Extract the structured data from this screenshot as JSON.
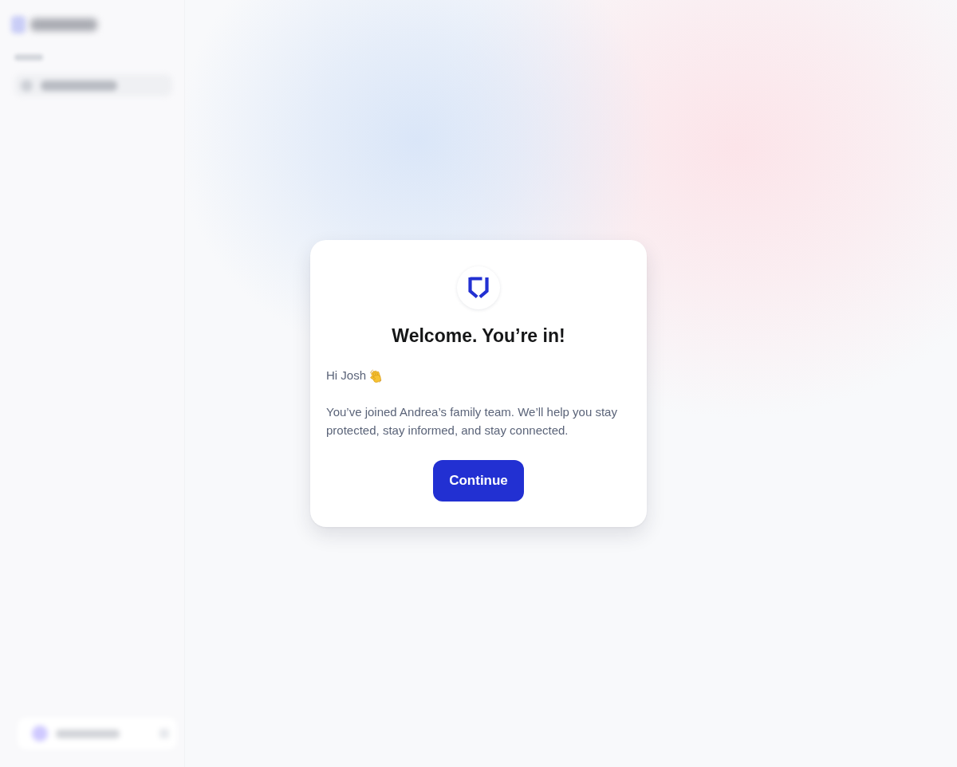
{
  "dialog": {
    "title": "Welcome. You’re in!",
    "greeting": "Hi Josh",
    "message": "You’ve joined Andrea’s family team. We’ll help you stay protected, stay informed, and stay connected.",
    "button": "Continue"
  }
}
